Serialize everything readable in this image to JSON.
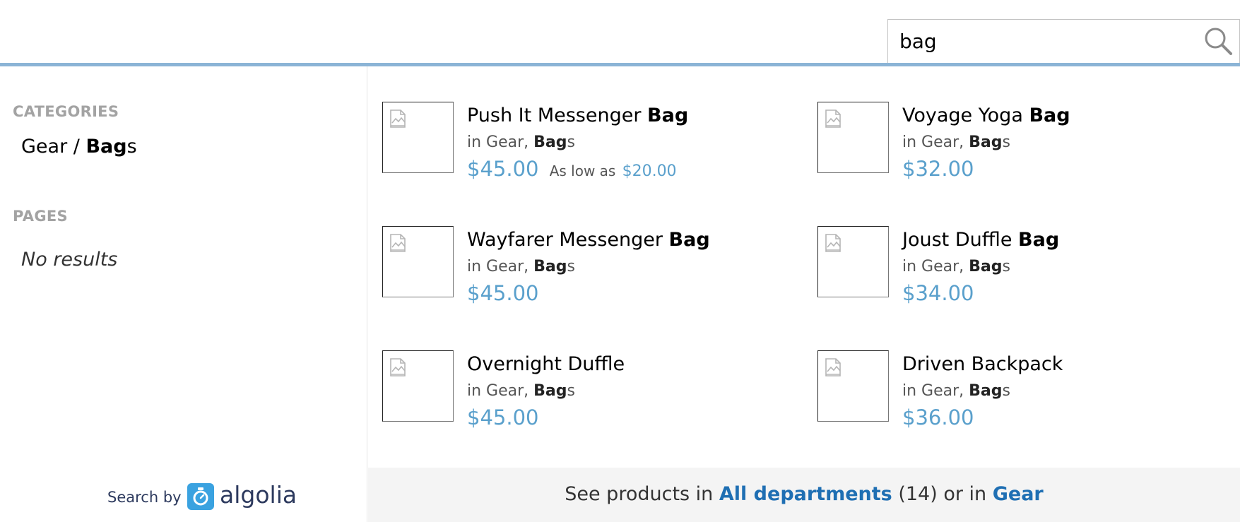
{
  "search": {
    "value": "bag"
  },
  "categories": {
    "title": "CATEGORIES",
    "item_prefix": "Gear / ",
    "item_highlight": "Bag",
    "item_suffix": "s"
  },
  "pages": {
    "title": "PAGES",
    "empty_text": "No results"
  },
  "products": [
    {
      "name": "Push It Messenger ",
      "highlight": "Bag",
      "cat_prefix": "in Gear, ",
      "cat_highlight": "Bag",
      "cat_suffix": "s",
      "price": "$45.00",
      "low_label": "As low as",
      "low_price": "$20.00"
    },
    {
      "name": "Voyage Yoga ",
      "highlight": "Bag",
      "cat_prefix": "in Gear, ",
      "cat_highlight": "Bag",
      "cat_suffix": "s",
      "price": "$32.00"
    },
    {
      "name": "Wayfarer Messenger ",
      "highlight": "Bag",
      "cat_prefix": "in Gear, ",
      "cat_highlight": "Bag",
      "cat_suffix": "s",
      "price": "$45.00"
    },
    {
      "name": "Joust Duffle ",
      "highlight": "Bag",
      "cat_prefix": "in Gear, ",
      "cat_highlight": "Bag",
      "cat_suffix": "s",
      "price": "$34.00"
    },
    {
      "name": "Overnight Duffle",
      "highlight": "",
      "cat_prefix": "in Gear, ",
      "cat_highlight": "Bag",
      "cat_suffix": "s",
      "price": "$45.00"
    },
    {
      "name": "Driven Backpack",
      "highlight": "",
      "cat_prefix": "in Gear, ",
      "cat_highlight": "Bag",
      "cat_suffix": "s",
      "price": "$36.00"
    }
  ],
  "footer": {
    "search_by": "Search by",
    "algolia": "algolia",
    "see_prefix": "See products in ",
    "all_departments": "All departments",
    "count": " (14) or in ",
    "gear": "Gear"
  },
  "colors": {
    "accent_line": "#8bb4d6",
    "price": "#5aa0cc",
    "link": "#1f6fb3",
    "algolia_badge": "#3aa2e0"
  }
}
